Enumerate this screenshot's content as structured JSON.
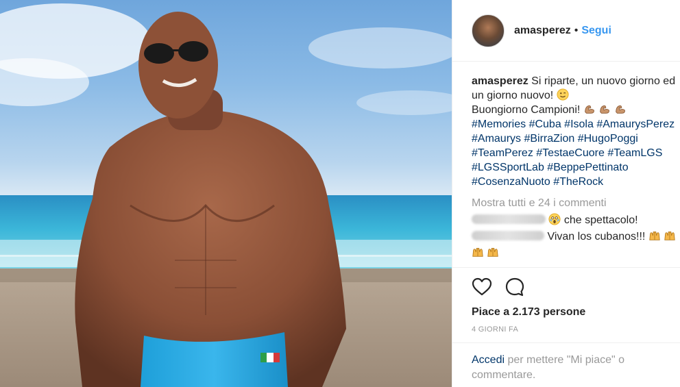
{
  "post": {
    "username": "amasperez",
    "separator": "•",
    "follow_label": "Segui",
    "caption_lines": [
      "Si riparte, un nuovo giorno ed",
      "un giorno nuovo!",
      "Buongiorno Campioni!"
    ],
    "hashtag_lines": [
      "#Memories #Cuba #Isola #AmaurysPerez",
      "#Amaurys #BirraZion #HugoPoggi",
      "#TeamPerez #TestaeCuore #TeamLGS",
      "#LGSSportLab #BeppePettinato",
      "#CosenzaNuoto #TheRock"
    ],
    "view_all_comments": "Mostra tutti e 24 i commenti",
    "comments": [
      {
        "text": "che spettacolo!",
        "emoji_before": "scream-emoji"
      },
      {
        "text": "Vivan los cubanos!!!",
        "emoji_after": "raised-hands-emoji"
      }
    ],
    "likes": "Piace a 2.173 persone",
    "date": "4 GIORNI FA",
    "login_link": "Accedi",
    "login_rest_1": " per mettere \"Mi piace\" o",
    "login_rest_2": "commentare."
  },
  "icons": {
    "like": "heart-icon",
    "comment": "comment-icon"
  },
  "colors": {
    "link_blue": "#3897f0",
    "hashtag": "#003569",
    "muted": "#999999",
    "text": "#262626"
  }
}
